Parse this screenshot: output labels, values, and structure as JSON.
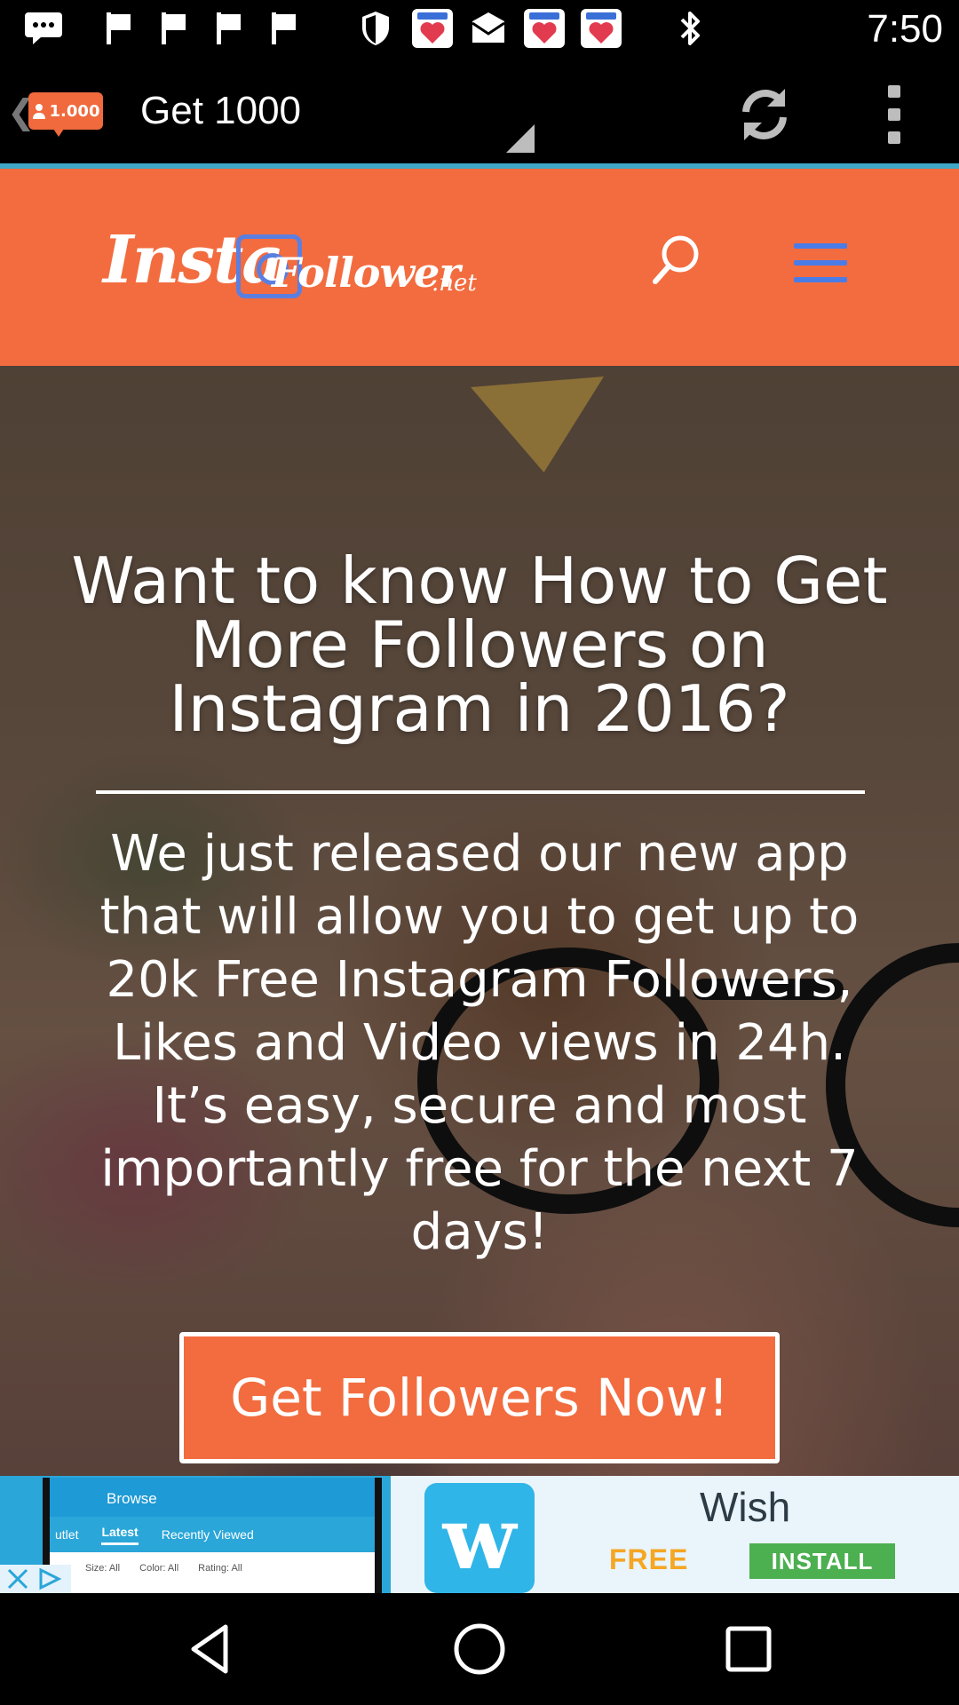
{
  "status_bar": {
    "clock": "7:50",
    "icons": [
      "chat-icon",
      "flag-icon",
      "flag-icon",
      "flag-icon",
      "flag-icon",
      "shield-icon",
      "fast-meet-heart-icon",
      "mail-icon",
      "fast-meet-heart-icon",
      "fast-meet-heart-icon",
      "bluetooth-icon"
    ]
  },
  "app_bar": {
    "badge_count": "1.000",
    "title": "Get 1000",
    "icons": [
      "back-icon",
      "refresh-icon",
      "overflow-menu-icon"
    ]
  },
  "site_header": {
    "logo_main": "Insta",
    "logo_rest": "Follower",
    "logo_tld": ".net",
    "background_color": "#f26c3f",
    "icons": [
      "search-icon",
      "hamburger-menu-icon"
    ]
  },
  "hero": {
    "title": "Want to know How to Get More Followers on Instagram in 2016?",
    "body": "We just released our new app that will allow you to get up to 20k Free Instagram Followers, Likes and Video views in 24h. It’s easy, secure and most importantly free for the next 7 days!",
    "cta_label": "Get Followers Now!"
  },
  "ad": {
    "app_screen_title": "Browse",
    "app_screen_tabs": [
      "utlet",
      "Latest",
      "Recently Viewed"
    ],
    "app_screen_filters": [
      "Size: All",
      "Color: All",
      "Rating: All"
    ],
    "brand": "Wish",
    "logo_letter": "w",
    "free_label": "FREE",
    "install_label": "INSTALL",
    "icons": [
      "close-icon",
      "adchoices-icon"
    ]
  },
  "nav_bar": {
    "icons": [
      "back-triangle-icon",
      "home-circle-icon",
      "recents-square-icon"
    ]
  }
}
